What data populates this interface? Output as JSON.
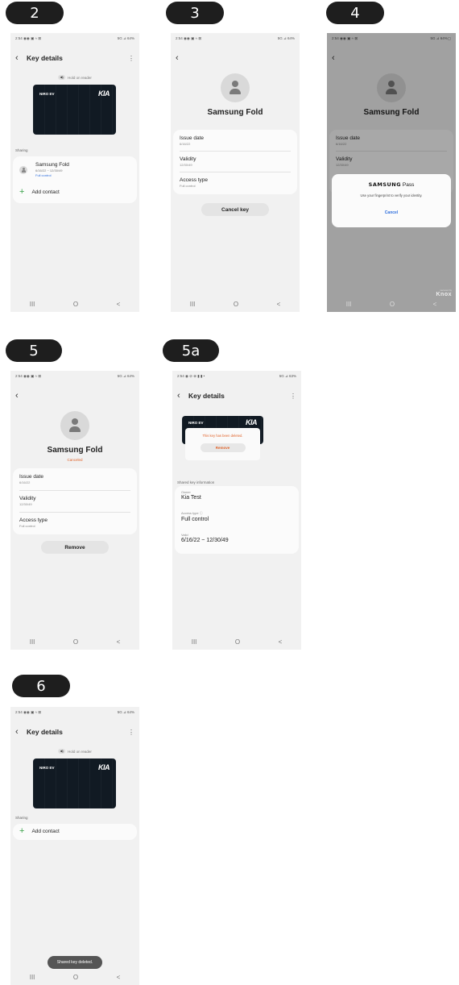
{
  "steps": {
    "s2": "2",
    "s3": "3",
    "s4": "4",
    "s5": "5",
    "s5a": "5a",
    "s6": "6"
  },
  "status": {
    "time": "2:54",
    "time_icons": "2:54 ◉◉ ▣ ≈ ⊠",
    "time_icons_5a": "2:54 ◉ ⊘ ⊗ ▮ ▮ •",
    "signal_64": "5G ⊿ 64%",
    "signal_63": "5G ⊿ 63%",
    "signal_dim": "5G ⊿ 64%▢"
  },
  "nav": {
    "recents": "III",
    "home": "O",
    "back": "<"
  },
  "key_details": {
    "title": "Key details",
    "reader_hint": "Hold on reader",
    "card_name": "NIRO EV",
    "card_logo": "KIA",
    "sharing_label": "Sharing",
    "contact_name": "Samsung Fold",
    "contact_period": "6/16/22 ~ 12/30/49",
    "contact_access": "Full control",
    "add_contact": "Add contact"
  },
  "detail": {
    "device_name": "Samsung Fold",
    "issue_label": "Issue date",
    "issue_value": "6/16/22",
    "validity_label": "Validity",
    "validity_value": "12/30/49",
    "access_label": "Access type",
    "access_value": "Full control",
    "cancel_key": "Cancel key",
    "canceled": "Canceled",
    "remove": "Remove"
  },
  "pass_dialog": {
    "brand": "SAMSUNG",
    "brand_suffix": "Pass",
    "message": "Use your fingerprint to verify your identity.",
    "cancel": "Cancel",
    "knox_small": "secured by",
    "knox": "Knox"
  },
  "deleted_view": {
    "message": "This key has been deleted.",
    "remove": "Remove",
    "section": "Shared key information",
    "owner_label": "Owner",
    "owner_value": "Kia Test",
    "access_label": "Access type",
    "access_value": "Full control",
    "valid_label": "Valid",
    "valid_value": "6/16/22 ~ 12/30/49"
  },
  "toast": "Shared key deleted."
}
